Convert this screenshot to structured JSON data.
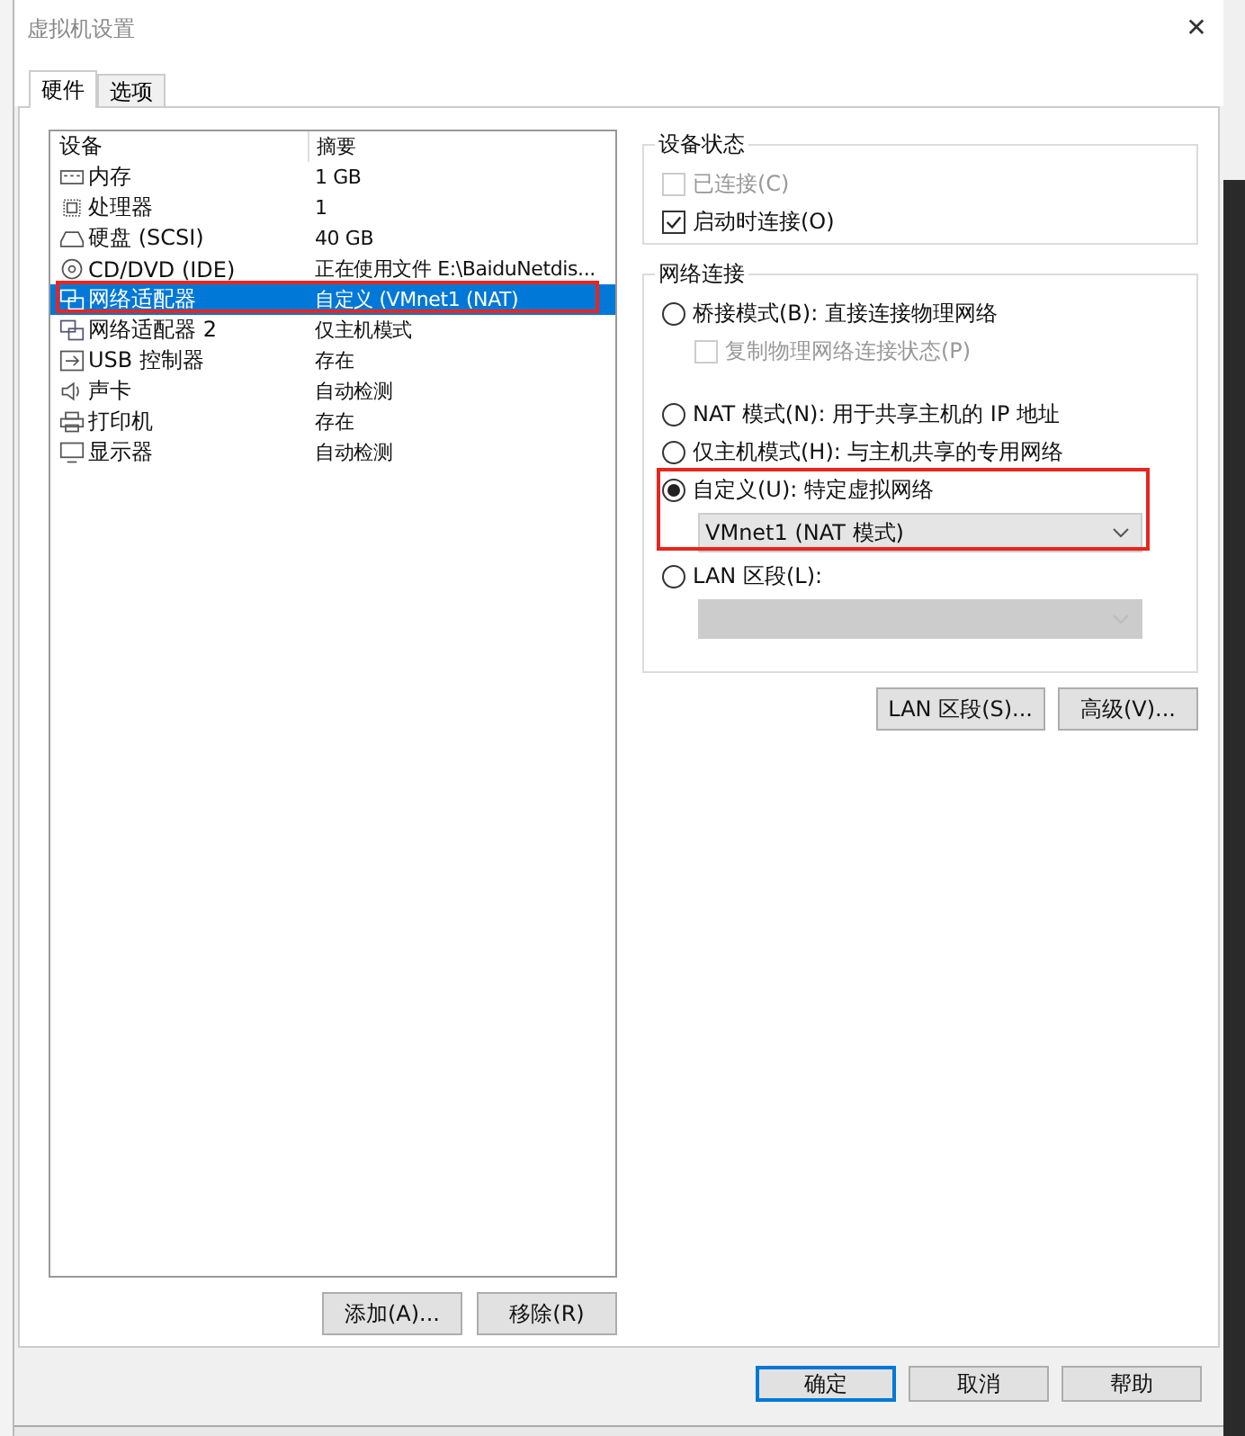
{
  "window": {
    "title": "虚拟机设置",
    "close": "✕"
  },
  "tabs": [
    {
      "label": "硬件",
      "selected": true
    },
    {
      "label": "选项",
      "selected": false
    }
  ],
  "device_list": {
    "columns": [
      "设备",
      "摘要"
    ],
    "rows": [
      {
        "name": "内存",
        "summary": "1 GB",
        "selected": false
      },
      {
        "name": "处理器",
        "summary": "1",
        "selected": false
      },
      {
        "name": "硬盘 (SCSI)",
        "summary": "40 GB",
        "selected": false
      },
      {
        "name": "CD/DVD (IDE)",
        "summary": "正在使用文件 E:\\BaiduNetdis...",
        "selected": false
      },
      {
        "name": "网络适配器",
        "summary": "自定义 (VMnet1 (NAT)",
        "selected": true
      },
      {
        "name": "网络适配器 2",
        "summary": "仅主机模式",
        "selected": false
      },
      {
        "name": "USB 控制器",
        "summary": "存在",
        "selected": false
      },
      {
        "name": "声卡",
        "summary": "自动检测",
        "selected": false
      },
      {
        "name": "打印机",
        "summary": "存在",
        "selected": false
      },
      {
        "name": "显示器",
        "summary": "自动检测",
        "selected": false
      }
    ],
    "buttons": [
      "添加(A)...",
      "移除(R)"
    ]
  },
  "device_status": {
    "title": "设备状态",
    "items": [
      {
        "label": "已连接(C)",
        "checked": false,
        "disabled": true
      },
      {
        "label": "启动时连接(O)",
        "checked": true,
        "disabled": false
      }
    ]
  },
  "network_connection": {
    "title": "网络连接",
    "items": [
      {
        "kind": "radio",
        "label": "桥接模式(B): 直接连接物理网络",
        "selected": false
      },
      {
        "kind": "checkbox",
        "label": "复制物理网络连接状态(P)",
        "checked": false,
        "disabled": true
      },
      {
        "kind": "radio",
        "label": "NAT 模式(N): 用于共享主机的 IP 地址",
        "selected": false
      },
      {
        "kind": "radio",
        "label": "仅主机模式(H): 与主机共享的专用网络",
        "selected": false
      },
      {
        "kind": "radio",
        "label": "自定义(U): 特定虚拟网络",
        "selected": true
      },
      {
        "kind": "dropdown",
        "value": "VMnet1 (NAT 模式)",
        "disabled": false
      },
      {
        "kind": "radio",
        "label": "LAN 区段(L):",
        "selected": false
      },
      {
        "kind": "dropdown",
        "disabled": true
      }
    ]
  },
  "network_buttons": [
    "LAN 区段(S)...",
    "高级(V)..."
  ],
  "footer_buttons": [
    {
      "label": "确定",
      "default": true
    },
    {
      "label": "取消",
      "default": false
    },
    {
      "label": "帮助",
      "default": false
    }
  ]
}
